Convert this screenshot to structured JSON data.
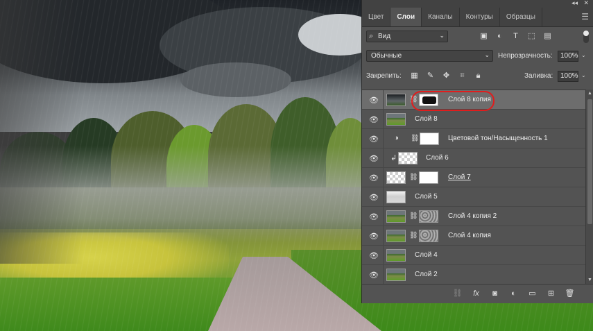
{
  "panel": {
    "tabs": [
      {
        "label": "Цвет"
      },
      {
        "label": "Слои"
      },
      {
        "label": "Каналы"
      },
      {
        "label": "Контуры"
      },
      {
        "label": "Образцы"
      }
    ],
    "active_tab": "Слои",
    "filter": {
      "label": "Вид"
    },
    "blend_mode": "Обычные",
    "opacity_label": "Непрозрачность:",
    "opacity_value": "100%",
    "lock_label": "Закрепить:",
    "fill_label": "Заливка:",
    "fill_value": "100%",
    "layers": [
      {
        "name": "Слой 8 копия",
        "selected": true,
        "highlighted": true
      },
      {
        "name": "Слой 8"
      },
      {
        "name": "Цветовой тон/Насыщенность 1"
      },
      {
        "name": "Слой 6"
      },
      {
        "name": "Слой 7"
      },
      {
        "name": "Слой 5"
      },
      {
        "name": "Слой 4 копия 2"
      },
      {
        "name": "Слой 4 копия"
      },
      {
        "name": "Слой 4"
      },
      {
        "name": "Слой 2"
      }
    ]
  },
  "colors": {
    "panel_bg": "#535353",
    "highlight_ring": "#e01d1d",
    "selected_row": "#6d6d6d"
  }
}
